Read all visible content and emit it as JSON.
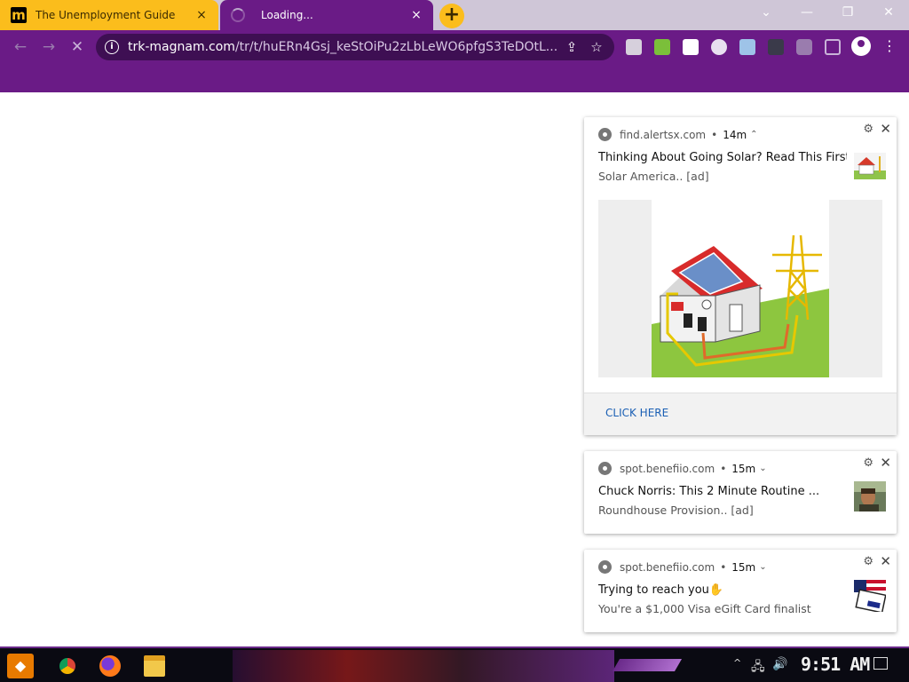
{
  "browser": {
    "tabs": [
      {
        "title": "The Unemployment Guide",
        "favicon_letter": "m",
        "close": "×"
      },
      {
        "title": "Loading...",
        "close": "×"
      }
    ],
    "new_tab": "+",
    "window_controls": {
      "tab_search": "⌄",
      "minimize": "—",
      "restore": "❐",
      "close": "✕"
    },
    "nav": {
      "back": "←",
      "forward": "→",
      "stop": "✕"
    },
    "url_domain": "trk-magnam.com",
    "url_path": "/tr/t/huERn4Gsj_keStOiPu2zLbLeWO6pfgS3TeDOtL...",
    "colors": {
      "theme": "#6a1b86",
      "tab_active": "#fbbd1c"
    }
  },
  "notifications": [
    {
      "source": "find.alertsx.com",
      "age": "14m",
      "expand": "⌃",
      "title": "Thinking About Going Solar? Read This First!",
      "subtitle": "Solar America.. [ad]",
      "action": "CLICK HERE",
      "thumb": "solar-house-thumbnail"
    },
    {
      "source": "spot.benefiio.com",
      "age": "15m",
      "expand": "⌄",
      "title": "Chuck Norris: This 2 Minute Routine ...",
      "subtitle": "Roundhouse Provision.. [ad]",
      "thumb": "man-portrait-thumbnail"
    },
    {
      "source": "spot.benefiio.com",
      "age": "15m",
      "expand": "⌄",
      "title": "Trying to reach you✋",
      "subtitle": "You're a $1,000 Visa eGift Card finalist",
      "thumb": "visa-card-thumbnail"
    }
  ],
  "notification_controls": {
    "settings": "⚙",
    "close": "✕",
    "separator": "•"
  },
  "taskbar": {
    "clock": "9:51 AM",
    "tray_chevron": "^",
    "network_icon": "🖧",
    "volume_icon": "🔊"
  }
}
